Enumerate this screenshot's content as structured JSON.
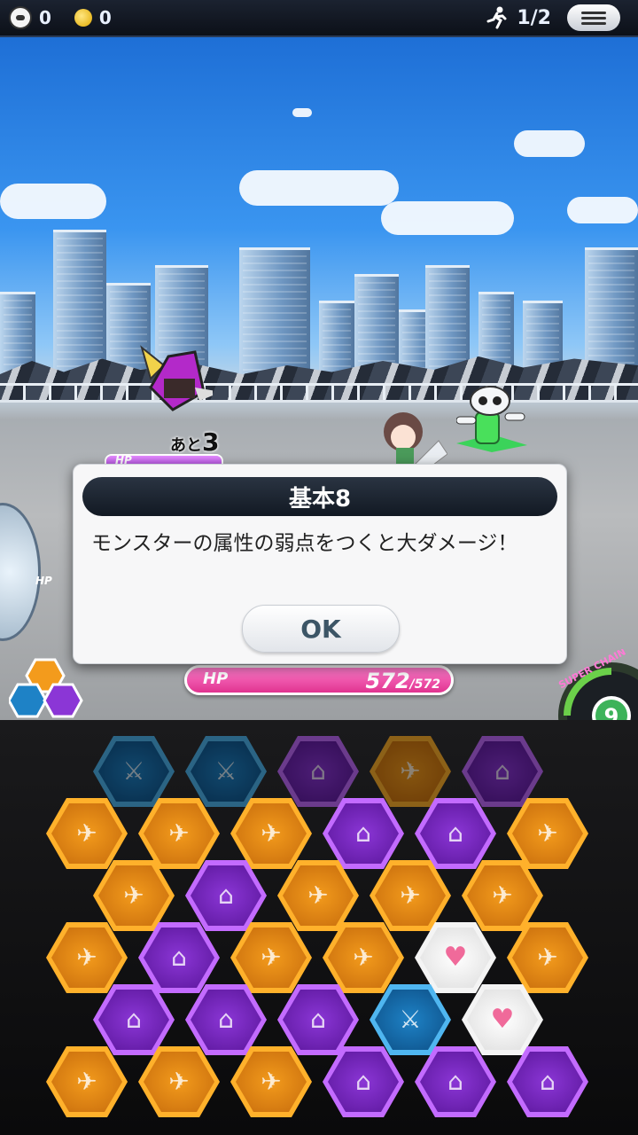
{
  "topbar": {
    "skull_count": "0",
    "coin_count": "0",
    "turn": "1/2"
  },
  "battle": {
    "enemy_countdown_prefix": "あと",
    "enemy_countdown_value": "3",
    "enemy_hp_label": "HP",
    "side_hp_label": "HP",
    "player_hp_label": "HP",
    "player_hp_current": "572",
    "player_hp_max": "/572",
    "super_chain_label": "SUPER CHAIN",
    "super_chain_value": "9"
  },
  "dialog": {
    "title": "基本8",
    "message": "モンスターの属性の弱点をつくと大ダメージ！",
    "ok_label": "OK"
  },
  "colors": {
    "orange": "#f39b1c",
    "purple": "#8b36d6",
    "blue": "#1e82c6",
    "heart": "#f06a9a",
    "hp_pink": "#e0338f"
  },
  "board": {
    "rows": [
      [
        "blue",
        "blue",
        "purple",
        "orange",
        "purple"
      ],
      [
        "orange",
        "orange",
        "orange",
        "purple",
        "purple",
        "orange"
      ],
      [
        "orange",
        "purple",
        "orange",
        "orange",
        "orange"
      ],
      [
        "orange",
        "purple",
        "orange",
        "orange",
        "heart",
        "orange"
      ],
      [
        "purple",
        "purple",
        "purple",
        "blue",
        "heart"
      ],
      [
        "orange",
        "orange",
        "orange",
        "purple",
        "purple",
        "purple"
      ]
    ]
  }
}
